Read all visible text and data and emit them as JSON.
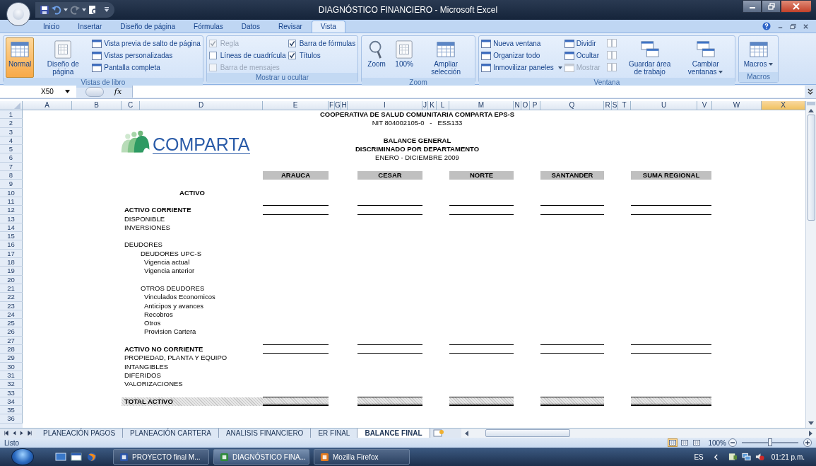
{
  "window": {
    "title": "DIAGNÓSTICO FINANCIERO - Microsoft Excel"
  },
  "ribbon_tabs": [
    {
      "label": "Inicio",
      "selected": false
    },
    {
      "label": "Insertar",
      "selected": false
    },
    {
      "label": "Diseño de página",
      "selected": false
    },
    {
      "label": "Fórmulas",
      "selected": false
    },
    {
      "label": "Datos",
      "selected": false
    },
    {
      "label": "Revisar",
      "selected": false
    },
    {
      "label": "Vista",
      "selected": true
    }
  ],
  "ribbon_groups": [
    {
      "label": "Vistas de libro",
      "parts": [
        {
          "kind": "large",
          "label": "Normal",
          "selected": true,
          "dropdown": false
        },
        {
          "kind": "large",
          "label": "Diseño de página",
          "selected": false,
          "dropdown": false
        },
        {
          "kind": "column",
          "items": [
            {
              "kind": "button",
              "label": "Vista previa de salto de página",
              "disabled": false,
              "dropdown": false
            },
            {
              "kind": "button",
              "label": "Vistas personalizadas",
              "disabled": false,
              "dropdown": false
            },
            {
              "kind": "button",
              "label": "Pantalla completa",
              "disabled": false,
              "dropdown": false
            }
          ]
        }
      ]
    },
    {
      "label": "Mostrar u ocultar",
      "parts": [
        {
          "kind": "column",
          "items": [
            {
              "kind": "check",
              "label": "Regla",
              "checked": true,
              "disabled": true
            },
            {
              "kind": "check",
              "label": "Líneas de cuadrícula",
              "checked": false,
              "disabled": false
            },
            {
              "kind": "check",
              "label": "Barra de mensajes",
              "checked": false,
              "disabled": true
            }
          ]
        },
        {
          "kind": "column",
          "items": [
            {
              "kind": "check",
              "label": "Barra de fórmulas",
              "checked": true,
              "disabled": false
            },
            {
              "kind": "check",
              "label": "Títulos",
              "checked": true,
              "disabled": false
            }
          ]
        }
      ]
    },
    {
      "label": "Zoom",
      "parts": [
        {
          "kind": "large",
          "label": "Zoom",
          "selected": false,
          "dropdown": false
        },
        {
          "kind": "large",
          "label": "100%",
          "selected": false,
          "dropdown": false
        },
        {
          "kind": "large",
          "label": "Ampliar selección",
          "selected": false,
          "dropdown": false
        }
      ]
    },
    {
      "label": "Ventana",
      "parts": [
        {
          "kind": "column",
          "items": [
            {
              "kind": "button",
              "label": "Nueva ventana",
              "disabled": false,
              "dropdown": false
            },
            {
              "kind": "button",
              "label": "Organizar todo",
              "disabled": false,
              "dropdown": false
            },
            {
              "kind": "button",
              "label": "Inmovilizar paneles",
              "disabled": false,
              "dropdown": true
            }
          ]
        },
        {
          "kind": "column",
          "items": [
            {
              "kind": "button",
              "label": "Dividir",
              "disabled": false,
              "dropdown": false
            },
            {
              "kind": "button",
              "label": "Ocultar",
              "disabled": false,
              "dropdown": false
            },
            {
              "kind": "button",
              "label": "Mostrar",
              "disabled": true,
              "dropdown": false
            }
          ]
        },
        {
          "kind": "column",
          "items": [
            {
              "kind": "icon",
              "disabled": true
            },
            {
              "kind": "icon",
              "disabled": true
            },
            {
              "kind": "icon",
              "disabled": true
            }
          ]
        },
        {
          "kind": "large",
          "label": "Guardar área de trabajo",
          "selected": false,
          "dropdown": false
        },
        {
          "kind": "large",
          "label": "Cambiar ventanas",
          "selected": false,
          "dropdown": true
        }
      ]
    },
    {
      "label": "Macros",
      "parts": [
        {
          "kind": "large",
          "label": "Macros",
          "selected": false,
          "dropdown": true
        }
      ]
    }
  ],
  "formula_bar": {
    "name_box": "X50",
    "function_label": "fx"
  },
  "columns": [
    {
      "label": "A",
      "selected": false
    },
    {
      "label": "B",
      "selected": false
    },
    {
      "label": "C",
      "selected": false
    },
    {
      "label": "D",
      "selected": false
    },
    {
      "label": "E",
      "selected": false
    },
    {
      "label": "F",
      "selected": false
    },
    {
      "label": "G",
      "selected": false
    },
    {
      "label": "H",
      "selected": false
    },
    {
      "label": "I",
      "selected": false
    },
    {
      "label": "J",
      "selected": false
    },
    {
      "label": "K",
      "selected": false
    },
    {
      "label": "L",
      "selected": false
    },
    {
      "label": "M",
      "selected": false
    },
    {
      "label": "N",
      "selected": false
    },
    {
      "label": "O",
      "selected": false
    },
    {
      "label": "P",
      "selected": false
    },
    {
      "label": "Q",
      "selected": false
    },
    {
      "label": "R",
      "selected": false
    },
    {
      "label": "S",
      "selected": false
    },
    {
      "label": "T",
      "selected": false
    },
    {
      "label": "U",
      "selected": false
    },
    {
      "label": "V",
      "selected": false
    },
    {
      "label": "W",
      "selected": false
    },
    {
      "label": "X",
      "selected": true
    }
  ],
  "sheet": {
    "row_numbers": [
      "1",
      "2",
      "3",
      "4",
      "5",
      "6",
      "7",
      "8",
      "9",
      "10",
      "11",
      "12",
      "13",
      "14",
      "15",
      "16",
      "17",
      "18",
      "19",
      "20",
      "21",
      "22",
      "23",
      "24",
      "25",
      "26",
      "27",
      "28",
      "29",
      "30",
      "31",
      "32",
      "33",
      "34",
      "35",
      "36"
    ],
    "organization": "COOPERATIVA DE SALUD COMUNITARIA COMPARTA EPS-S",
    "tax_id": "NIT 804002105-0   -   ESS133",
    "logo_text": "COMPARTA",
    "report": {
      "title": "BALANCE GENERAL",
      "subtitle": "DISCRIMINADO POR DEPARTAMENTO",
      "period": "ENERO - DICIEMBRE 2009"
    },
    "departments": [
      "ARAUCA",
      "CESAR",
      "NORTE",
      "SANTANDER",
      "SUMA REGIONAL"
    ],
    "section": "ACTIVO",
    "groups": [
      {
        "title": "ACTIVO CORRIENTE",
        "accounts": [
          {
            "label": "DISPONIBLE"
          },
          {
            "label": "INVERSIONES"
          },
          {
            "label": "DEUDORES",
            "children": [
              {
                "label": "DEUDORES UPC-S",
                "children": [
                  {
                    "label": "Vigencia actual"
                  },
                  {
                    "label": "Vigencia anterior"
                  }
                ]
              },
              {
                "label": "OTROS DEUDORES",
                "children": [
                  {
                    "label": "Vinculados Economicos"
                  },
                  {
                    "label": "Anticipos y avances"
                  },
                  {
                    "label": "Recobros"
                  },
                  {
                    "label": "Otros"
                  },
                  {
                    "label": "Provision Cartera"
                  }
                ]
              }
            ]
          }
        ]
      },
      {
        "title": "ACTIVO NO CORRIENTE",
        "accounts": [
          {
            "label": "PROPIEDAD, PLANTA Y EQUIPO"
          },
          {
            "label": "INTANGIBLES"
          },
          {
            "label": "DIFERIDOS"
          },
          {
            "label": "VALORIZACIONES"
          }
        ]
      }
    ],
    "total": "TOTAL ACTIVO"
  },
  "sheet_tabs": [
    {
      "label": "PLANEACIÓN PAGOS",
      "selected": false
    },
    {
      "label": "PLANEACIÓN CARTERA",
      "selected": false
    },
    {
      "label": "ANALISIS FINANCIERO",
      "selected": false
    },
    {
      "label": "ER FINAL",
      "selected": false
    },
    {
      "label": "BALANCE FINAL",
      "selected": true
    }
  ],
  "status_bar": {
    "text": "Listo",
    "view_buttons": [
      {
        "selected": true
      },
      {
        "selected": false
      },
      {
        "selected": false
      }
    ],
    "zoom": "100%",
    "zoom_slider": {
      "level": 0.5
    }
  },
  "taskbar": {
    "tasks": [
      {
        "label": "PROYECTO final M...",
        "selected": false
      },
      {
        "label": "DIAGNÓSTICO FINA...",
        "selected": true
      },
      {
        "label": "Mozilla Firefox",
        "selected": false
      }
    ],
    "language": "ES",
    "clock": "01:21 p.m."
  }
}
